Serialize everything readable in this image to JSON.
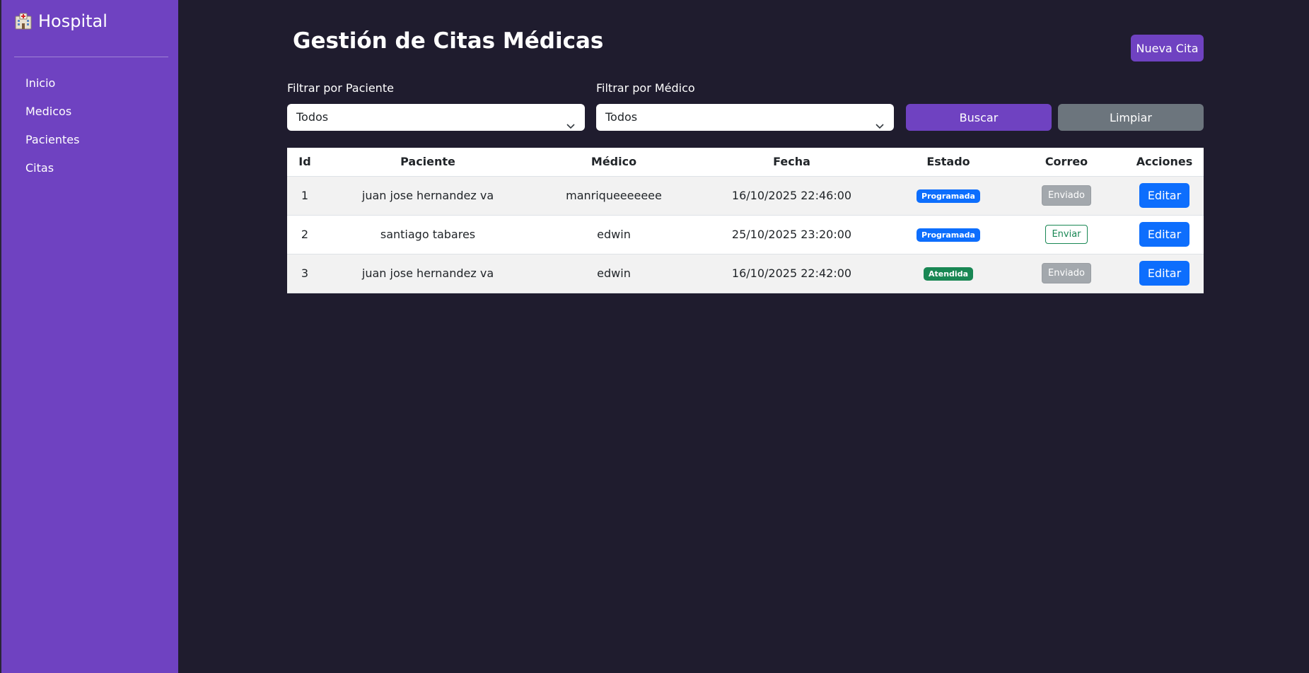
{
  "sidebar": {
    "brand": "Hospital",
    "brand_icon": "hospital-icon",
    "items": [
      {
        "label": "Inicio"
      },
      {
        "label": "Medicos"
      },
      {
        "label": "Pacientes"
      },
      {
        "label": "Citas"
      }
    ],
    "background_color": "#6f42c1"
  },
  "header": {
    "title": "Gestión de Citas Médicas",
    "new_button": "Nueva Cita"
  },
  "filters": {
    "patient_label": "Filtrar por Paciente",
    "patient_value": "Todos",
    "doctor_label": "Filtrar por Médico",
    "doctor_value": "Todos",
    "search_button": "Buscar",
    "clear_button": "Limpiar"
  },
  "table": {
    "columns": [
      "Id",
      "Paciente",
      "Médico",
      "Fecha",
      "Estado",
      "Correo",
      "Acciones"
    ],
    "rows": [
      {
        "id": "1",
        "paciente": "juan jose hernandez va",
        "medico": "manriqueeeeeee",
        "fecha": "16/10/2025 22:46:00",
        "estado": "Programada",
        "correo": "Enviado",
        "accion": "Editar"
      },
      {
        "id": "2",
        "paciente": "santiago tabares",
        "medico": "edwin",
        "fecha": "25/10/2025 23:20:00",
        "estado": "Programada",
        "correo": "Enviar",
        "accion": "Editar"
      },
      {
        "id": "3",
        "paciente": "juan jose hernandez va",
        "medico": "edwin",
        "fecha": "16/10/2025 22:42:00",
        "estado": "Atendida",
        "correo": "Enviado",
        "accion": "Editar"
      }
    ]
  },
  "colors": {
    "background": "#1f1c2e",
    "accent": "#6f42c1",
    "primary": "#0d6efd",
    "success": "#198754",
    "secondary": "#6c757d"
  }
}
